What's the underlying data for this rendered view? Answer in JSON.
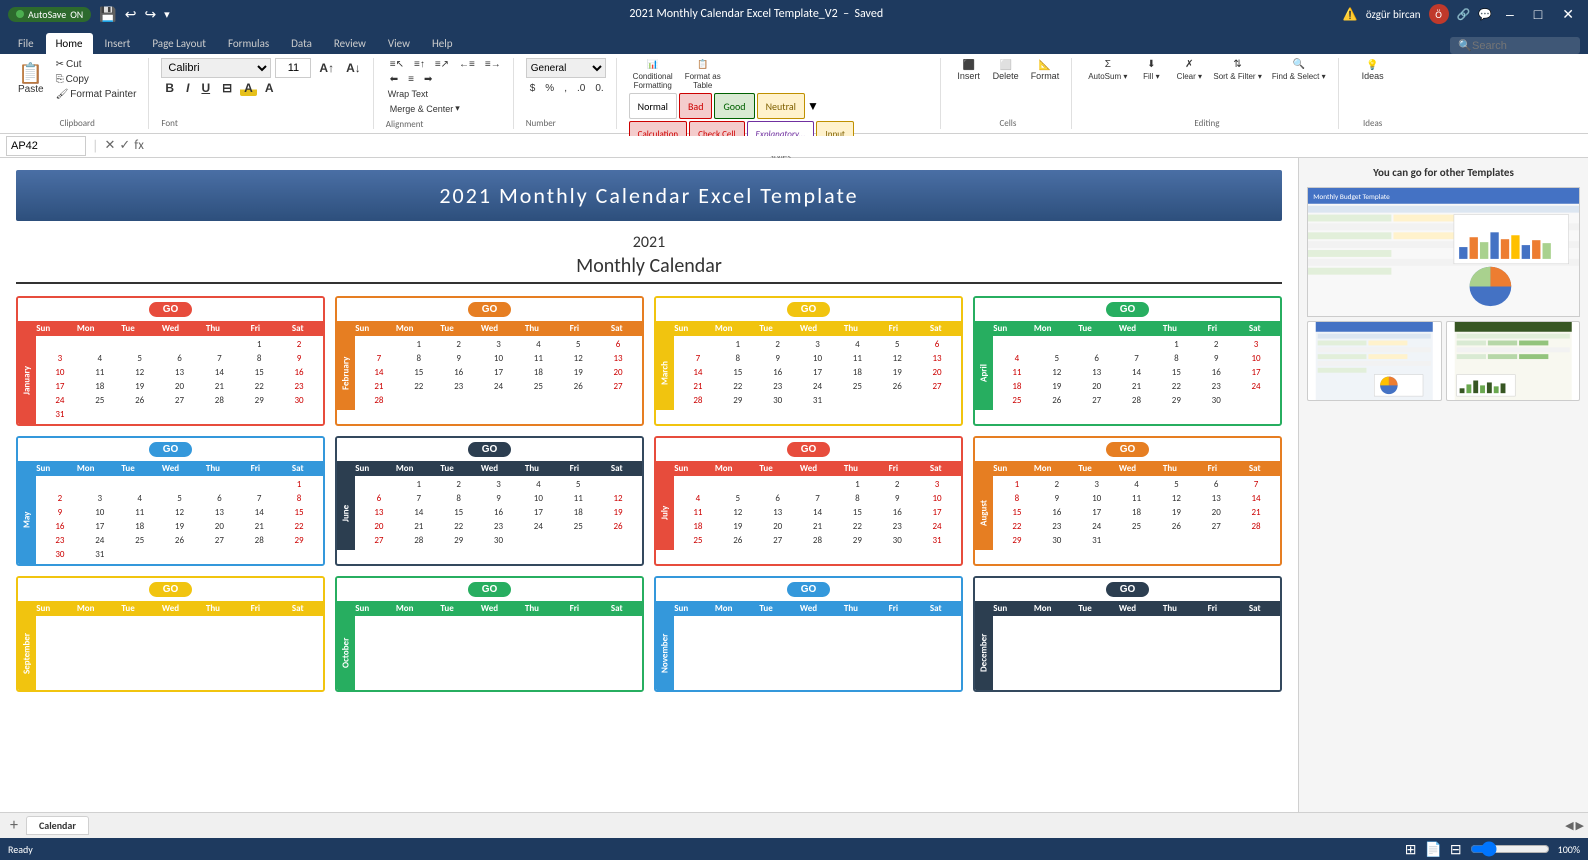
{
  "titlebar": {
    "filename": "2021 Monthly Calendar Excel Template_V2",
    "saved_status": "Saved",
    "autosave_label": "AutoSave",
    "autosave_on": "ON",
    "user": "özgür bircan",
    "close": "✕",
    "minimize": "–",
    "maximize": "□"
  },
  "ribbon": {
    "tabs": [
      "File",
      "Home",
      "Insert",
      "Page Layout",
      "Formulas",
      "Data",
      "Review",
      "View",
      "Help"
    ],
    "active_tab": "Home",
    "groups": {
      "clipboard": {
        "label": "Clipboard",
        "paste": "Paste",
        "cut": "Cut",
        "copy": "Copy",
        "format_painter": "Format Painter"
      },
      "font": {
        "label": "Font",
        "name": "Calibri",
        "size": "11"
      },
      "alignment": {
        "label": "Alignment",
        "wrap_text": "Wrap Text",
        "merge_center": "Merge & Center"
      },
      "number": {
        "label": "Number",
        "format": "General"
      },
      "styles": {
        "label": "Styles",
        "conditional": "Conditional Formatting",
        "format_as_table": "Format as Table",
        "normal": "Normal",
        "bad": "Bad",
        "good": "Good",
        "neutral": "Neutral",
        "calculation": "Calculation",
        "check_cell": "Check Cell",
        "explanatory": "Explanatory...",
        "input": "Input"
      },
      "cells": {
        "label": "Cells",
        "insert": "Insert",
        "delete": "Delete",
        "format": "Format"
      },
      "editing": {
        "label": "Editing",
        "autosum": "AutoSum",
        "fill": "Fill",
        "clear": "Clear",
        "sort_filter": "Sort & Filter",
        "find_select": "Find & Select"
      },
      "ideas": {
        "label": "Ideas",
        "ideas": "Ideas"
      }
    }
  },
  "formula_bar": {
    "cell_ref": "AP42",
    "cancel": "✕",
    "confirm": "✓",
    "fx": "fx",
    "value": ""
  },
  "search": {
    "placeholder": "Search",
    "value": ""
  },
  "calendar": {
    "banner": "2021 Monthly Calendar Excel Template",
    "year": "2021",
    "subtitle": "Monthly Calendar",
    "months": [
      {
        "name": "January",
        "short": "Jan",
        "color": "#e74c3c",
        "go_color": "#e74c3c",
        "border": "#e74c3c",
        "days": [
          "",
          "",
          "",
          "",
          "",
          "1",
          "2",
          "3",
          "4",
          "5",
          "6",
          "7",
          "8",
          "9",
          "10",
          "11",
          "12",
          "13",
          "14",
          "15",
          "16",
          "17",
          "18",
          "19",
          "20",
          "21",
          "22",
          "23",
          "24",
          "25",
          "26",
          "27",
          "28",
          "29",
          "30",
          "31",
          "",
          "",
          "",
          "",
          "",
          ""
        ]
      },
      {
        "name": "February",
        "short": "Feb",
        "color": "#e67e22",
        "go_color": "#e67e22",
        "border": "#e67e22",
        "days": [
          "",
          "1",
          "2",
          "3",
          "4",
          "5",
          "6",
          "7",
          "8",
          "9",
          "10",
          "11",
          "12",
          "13",
          "14",
          "15",
          "16",
          "17",
          "18",
          "19",
          "20",
          "21",
          "22",
          "23",
          "24",
          "25",
          "26",
          "27",
          "28",
          "",
          "",
          "",
          "",
          "",
          ""
        ]
      },
      {
        "name": "March",
        "short": "Mar",
        "color": "#f1c40f",
        "go_color": "#f1c40f",
        "border": "#f1c40f",
        "days": [
          "",
          "1",
          "2",
          "3",
          "4",
          "5",
          "6",
          "7",
          "8",
          "9",
          "10",
          "11",
          "12",
          "13",
          "14",
          "15",
          "16",
          "17",
          "18",
          "19",
          "20",
          "21",
          "22",
          "23",
          "24",
          "25",
          "26",
          "27",
          "28",
          "29",
          "30",
          "31",
          "",
          "",
          ""
        ]
      },
      {
        "name": "April",
        "short": "Apr",
        "color": "#27ae60",
        "go_color": "#27ae60",
        "border": "#27ae60",
        "days": [
          "",
          "",
          "",
          "",
          "1",
          "2",
          "3",
          "4",
          "5",
          "6",
          "7",
          "8",
          "9",
          "10",
          "11",
          "12",
          "13",
          "14",
          "15",
          "16",
          "17",
          "18",
          "19",
          "20",
          "21",
          "22",
          "23",
          "24",
          "25",
          "26",
          "27",
          "28",
          "29",
          "30",
          ""
        ]
      },
      {
        "name": "May",
        "short": "May",
        "color": "#3498db",
        "go_color": "#3498db",
        "border": "#3498db",
        "days": [
          "",
          "",
          "",
          "",
          "",
          "",
          "1",
          "2",
          "3",
          "4",
          "5",
          "6",
          "7",
          "8",
          "9",
          "10",
          "11",
          "12",
          "13",
          "14",
          "15",
          "16",
          "17",
          "18",
          "19",
          "20",
          "21",
          "22",
          "23",
          "24",
          "25",
          "26",
          "27",
          "28",
          "29",
          "30",
          "31",
          "",
          "",
          "",
          "",
          ""
        ]
      },
      {
        "name": "June",
        "short": "Jun",
        "color": "#2c3e50",
        "go_color": "#2c3e50",
        "border": "#34495e",
        "days": [
          "",
          "1",
          "2",
          "3",
          "4",
          "5",
          "",
          "6",
          "7",
          "8",
          "9",
          "10",
          "11",
          "12",
          "13",
          "14",
          "15",
          "16",
          "17",
          "18",
          "19",
          "20",
          "21",
          "22",
          "23",
          "24",
          "25",
          "26",
          "27",
          "28",
          "29",
          "30",
          "",
          "",
          ""
        ]
      },
      {
        "name": "July",
        "short": "Jul",
        "color": "#e74c3c",
        "go_color": "#e74c3c",
        "border": "#e74c3c",
        "days": [
          "",
          "",
          "",
          "",
          "1",
          "2",
          "3",
          "4",
          "5",
          "6",
          "7",
          "8",
          "9",
          "10",
          "11",
          "12",
          "13",
          "14",
          "15",
          "16",
          "17",
          "18",
          "19",
          "20",
          "21",
          "22",
          "23",
          "24",
          "25",
          "26",
          "27",
          "28",
          "29",
          "30",
          "31"
        ]
      },
      {
        "name": "August",
        "short": "Aug",
        "color": "#e67e22",
        "go_color": "#e67e22",
        "border": "#e67e22",
        "days": [
          "1",
          "2",
          "3",
          "4",
          "5",
          "6",
          "7",
          "8",
          "9",
          "10",
          "11",
          "12",
          "13",
          "14",
          "15",
          "16",
          "17",
          "18",
          "19",
          "20",
          "21",
          "22",
          "23",
          "24",
          "25",
          "26",
          "27",
          "28",
          "29",
          "30",
          "31",
          "",
          "",
          "",
          ""
        ]
      },
      {
        "name": "September",
        "short": "Sep",
        "color": "#f1c40f",
        "go_color": "#f1c40f",
        "border": "#f1c40f",
        "days": []
      },
      {
        "name": "October",
        "short": "Oct",
        "color": "#27ae60",
        "go_color": "#27ae60",
        "border": "#27ae60",
        "days": []
      },
      {
        "name": "November",
        "short": "Nov",
        "color": "#3498db",
        "go_color": "#3498db",
        "border": "#3498db",
        "days": []
      },
      {
        "name": "December",
        "short": "Dec",
        "color": "#2c3e50",
        "go_color": "#2c3e50",
        "border": "#34495e",
        "days": []
      }
    ],
    "day_headers": [
      "Sun",
      "Mon",
      "Tue",
      "Wed",
      "Thu",
      "Fri",
      "Sat"
    ]
  },
  "right_panel": {
    "label_start": "You can go for other ",
    "label_bold": "Templates"
  },
  "status_bar": {
    "ready": "Ready",
    "sheet_tabs": [
      "Calendar"
    ],
    "zoom": "100%"
  }
}
